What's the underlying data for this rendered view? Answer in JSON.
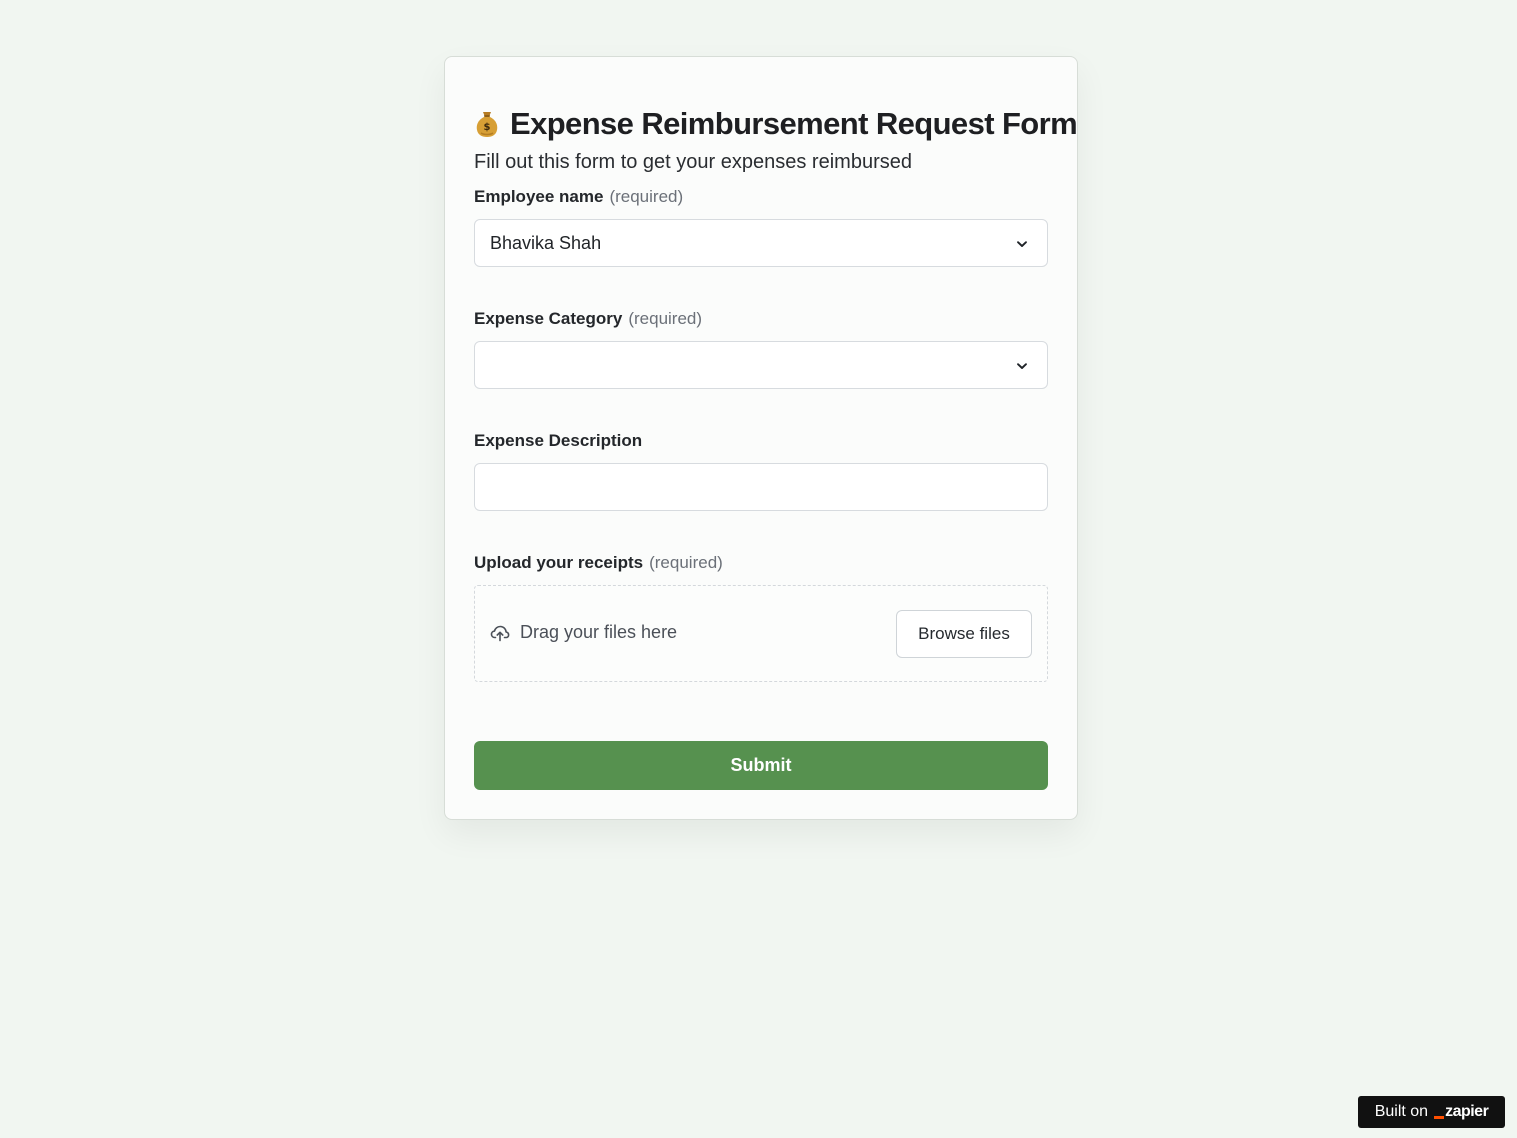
{
  "page": {
    "title": "Expense Reimbursement Request Form",
    "subtitle": "Fill out this form to get your expenses reimbursed",
    "title_icon": "money-bag-icon"
  },
  "fields": {
    "employee_name": {
      "label": "Employee name",
      "required_text": "(required)",
      "value": "Bhavika Shah",
      "arrow_icon": "chevron-down-icon"
    },
    "expense_category": {
      "label": "Expense Category",
      "required_text": "(required)",
      "value": "",
      "arrow_icon": "chevron-down-icon"
    },
    "expense_description": {
      "label": "Expense Description",
      "value": ""
    },
    "receipts": {
      "label": "Upload your receipts",
      "required_text": "(required)",
      "hint": "Drag your files here",
      "browse_label": "Browse files",
      "upload_icon": "cloud-upload-icon"
    }
  },
  "actions": {
    "submit_label": "Submit"
  },
  "badge": {
    "text": "Built on",
    "brand": "zapier"
  },
  "colors": {
    "background": "#f1f6f1",
    "card": "#fbfcfb",
    "submit": "#56914f",
    "badge": "#111111",
    "zapier_orange": "#ff4f00"
  }
}
